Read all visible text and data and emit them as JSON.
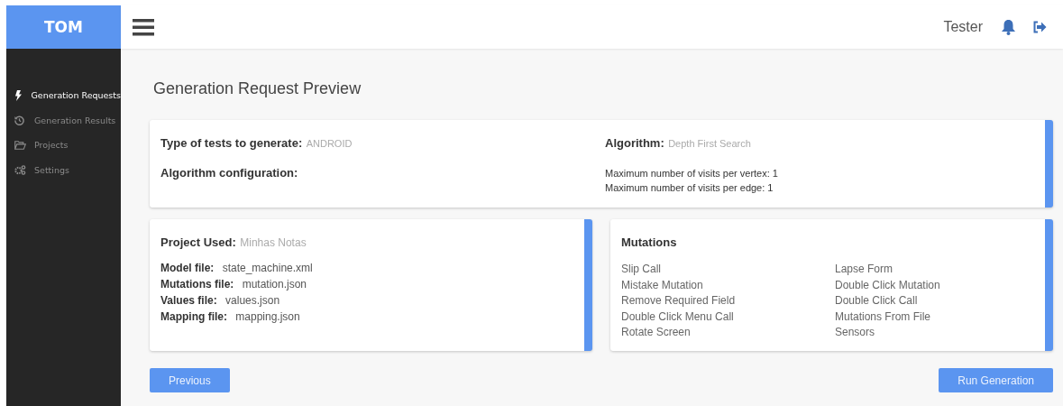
{
  "brand": "TOM",
  "user": {
    "name": "Tester"
  },
  "sidebar": {
    "items": [
      {
        "label": "Generation Requests",
        "selected": true
      },
      {
        "label": "Generation Results",
        "selected": false
      },
      {
        "label": "Projects",
        "selected": false
      },
      {
        "label": "Settings",
        "selected": false
      }
    ]
  },
  "page_title": "Generation Request Preview",
  "summary": {
    "type_label": "Type of tests to generate:",
    "type_value": "ANDROID",
    "algorithm_label": "Algorithm:",
    "algorithm_value": "Depth First Search",
    "config_label": "Algorithm configuration:",
    "config_lines": [
      "Maximum number of visits per vertex: 1",
      "Maximum number of visits per edge: 1"
    ]
  },
  "project": {
    "label": "Project Used:",
    "value": "Minhas Notas",
    "files": [
      {
        "label": "Model file:",
        "value": "state_machine.xml"
      },
      {
        "label": "Mutations file:",
        "value": "mutation.json"
      },
      {
        "label": "Values file:",
        "value": "values.json"
      },
      {
        "label": "Mapping file:",
        "value": "mapping.json"
      }
    ]
  },
  "mutations": {
    "title": "Mutations",
    "items": [
      "Slip Call",
      "Mistake Mutation",
      "Remove Required Field",
      "Double Click Menu Call",
      "Rotate Screen",
      "Lapse Form",
      "Double Click Mutation",
      "Double Click Call",
      "Mutations From File",
      "Sensors"
    ]
  },
  "buttons": {
    "previous": "Previous",
    "run": "Run Generation"
  }
}
